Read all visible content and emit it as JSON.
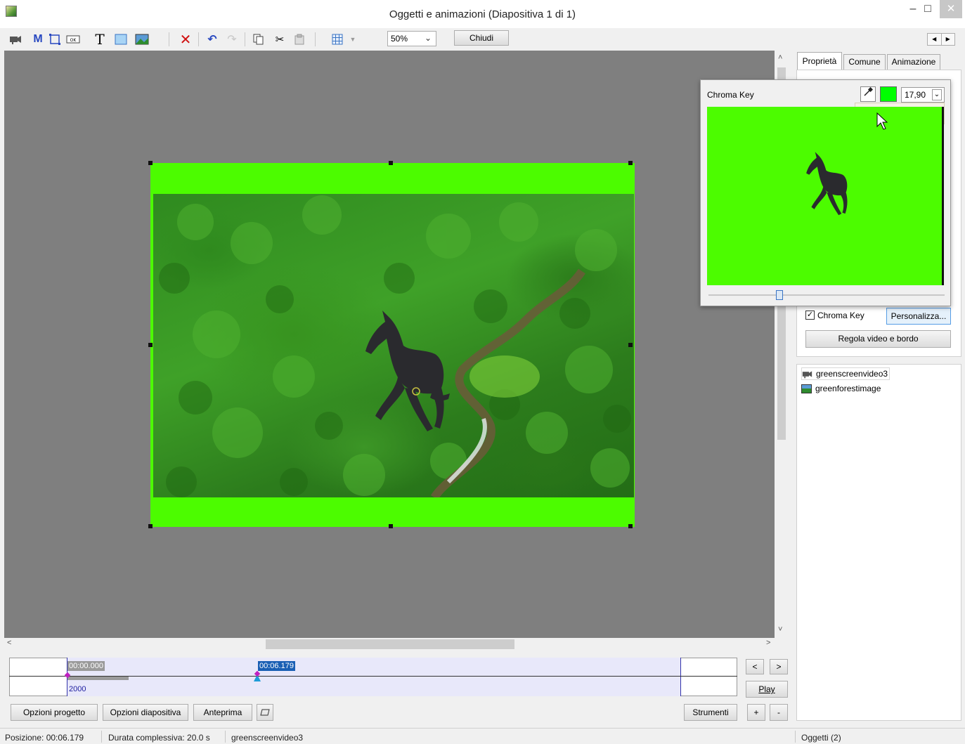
{
  "window": {
    "title": "Oggetti e animazioni  (Diapositiva 1 di 1)",
    "min": "–",
    "max": "□",
    "close": "✕"
  },
  "toolbar": {
    "zoom": "50%",
    "close_label": "Chiudi",
    "icons": [
      "video-icon",
      "mask-icon",
      "frame-icon",
      "button-icon",
      "text-icon",
      "rectangle-icon",
      "image-icon",
      "delete-icon",
      "undo-icon",
      "redo-icon",
      "copy-icon",
      "cut-icon",
      "paste-icon",
      "grid-icon"
    ]
  },
  "timeline": {
    "start": "00:00.000",
    "position": "00:06.179",
    "duration_ms": "2000"
  },
  "timeline_buttons": {
    "prev": "<",
    "next": ">",
    "play": "Play",
    "plus": "+",
    "minus": "-"
  },
  "bottom": {
    "project_options": "Opzioni progetto",
    "slide_options": "Opzioni diapositiva",
    "preview": "Anteprima",
    "tools": "Strumenti"
  },
  "status": {
    "position": "Posizione:  00:06.179",
    "total_duration": "Durata complessiva:  20.0 s",
    "selected": "greenscreenvideo3",
    "objects": "Oggetti (2)"
  },
  "panel": {
    "tabs": [
      "Proprietà",
      "Comune",
      "Animazione"
    ],
    "chroma_key_label": "Chroma Key",
    "chroma_key_checked": true,
    "customize": "Personalizza...",
    "adjust": "Regola video e bordo",
    "objects": [
      "greenscreenvideo3",
      "greenforestimage"
    ]
  },
  "chroma_popup": {
    "title": "Chroma Key",
    "key_color": "#00ff00",
    "tolerance": "17,90"
  },
  "colors": {
    "canvas": "#7f7f7f",
    "green_screen": "#4cfc00",
    "accent": "#1a5fb4"
  }
}
